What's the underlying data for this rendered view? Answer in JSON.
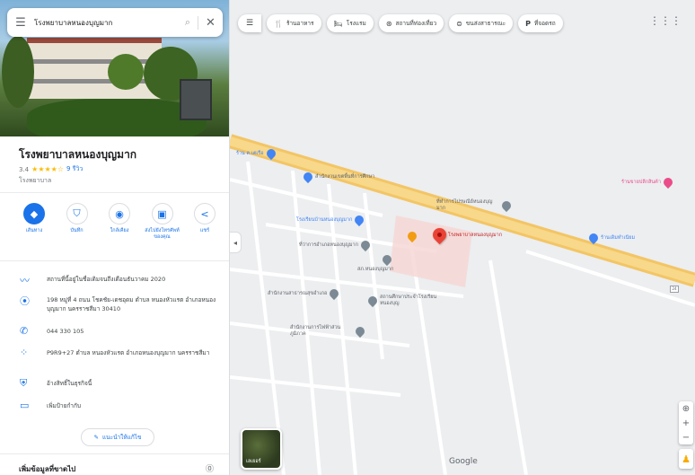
{
  "search": {
    "query": "โรงพยาบาลหนองบุญมาก"
  },
  "place": {
    "title": "โรงพยาบาลหนองบุญมาก",
    "rating": "3.4",
    "stars": "★★★★☆",
    "review_count": "9 รีวิว",
    "category": "โรงพยาบาล"
  },
  "actions": [
    {
      "icon": "◆",
      "label": "เส้นทาง",
      "icon_name": "directions-icon"
    },
    {
      "icon": "⛉",
      "label": "บันทึก",
      "icon_name": "bookmark-icon"
    },
    {
      "icon": "◉",
      "label": "ใกล้เคียง",
      "icon_name": "nearby-icon"
    },
    {
      "icon": "▣",
      "label": "ส่งไปยังโทรศัพท์ของคุณ",
      "icon_name": "phone-send-icon"
    },
    {
      "icon": "<",
      "label": "แชร์",
      "icon_name": "share-icon"
    }
  ],
  "info": {
    "updated": "สถานที่นี้อยู่ในชื่อเดิมจนถึงเดือนธันวาคม 2020",
    "address": "198 หมู่ที่ 4 ถนน โชคชัย-เดชอุดม ตำบล หนองหัวแรต อำเภอหนองบุญมาก นครราชสีมา 30410",
    "phone": "044 330 105",
    "plus_code": "P9R9+27 ตำบล หนองหัวแรต อำเภอหนองบุญมาก นครราชสีมา",
    "claim": "อ้างสิทธิ์ในธุรกิจนี้",
    "label": "เพิ่มป้ายกำกับ"
  },
  "suggest_edit": "แนะนำให้แก้ไข",
  "more_header": "เพิ่มข้อมูลที่ขาดไป",
  "chips": [
    {
      "icon": "🍴",
      "label": "ร้านอาหาร"
    },
    {
      "icon": "🛏",
      "label": "โรงแรม"
    },
    {
      "icon": "⊛",
      "label": "สถานที่ท่องเที่ยว"
    },
    {
      "icon": "⊜",
      "label": "ขนส่งสาธารณะ"
    },
    {
      "icon": "P",
      "label": "ที่จอดรถ"
    }
  ],
  "map": {
    "main_label": "โรงพยาบาลหนองบุญมาก",
    "poi_labels": {
      "shop_top_left": "ร้าน ค.เตเรือ",
      "poi_a": "สำนักงานเขตพื้นที่การศึกษา",
      "poi_b": "ที่ทำการไปรษณีย์หนองบุญมาก",
      "poi_c": "โรงเรียนบ้านหนองบุญมาก",
      "poi_d": "ที่ว่าการอำเภอหนองบุญมาก",
      "poi_e": "สภ.หนองบุญมาก",
      "poi_f": "สำนักงานสาธารณสุขอำเภอ",
      "poi_g": "สถานศึกษาประจำโรงเรียนหนองบุญ",
      "poi_h": "สำนักงานการไฟฟ้าส่วนภูมิภาค",
      "poi_right": "ร้านเดิมทำเนียม",
      "poi_pink": "ร้านขายปลีกสินค้า"
    },
    "layer_label": "เลเยอร์",
    "google": "Google",
    "road_number": "24"
  }
}
